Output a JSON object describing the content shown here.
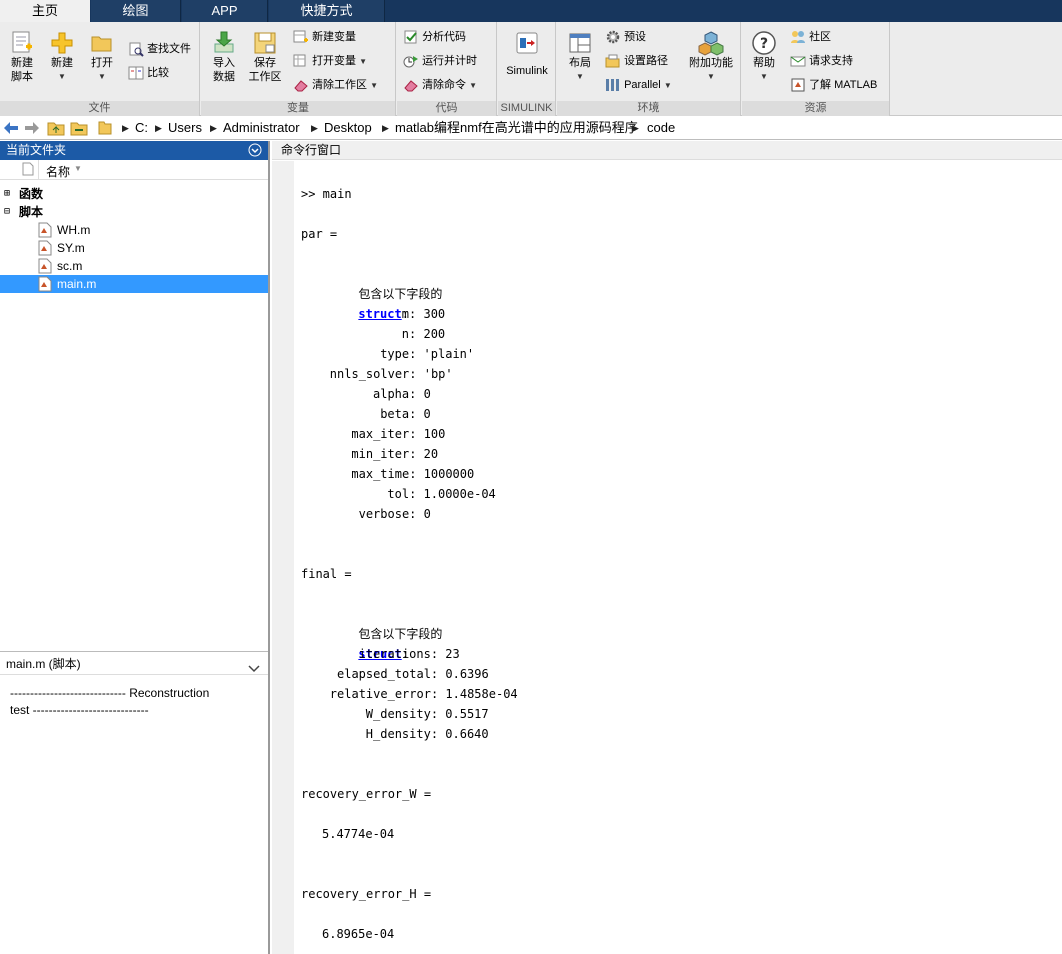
{
  "tabs": [
    "主页",
    "绘图",
    "APP",
    "快捷方式"
  ],
  "ribbon": {
    "file": {
      "label": "文件",
      "new_script": "新建\n脚本",
      "new": "新建",
      "open": "打开",
      "find_files": "查找文件",
      "compare": "比较"
    },
    "variable": {
      "label": "变量",
      "import_data": "导入\n数据",
      "save_workspace": "保存\n工作区",
      "new_variable": "新建变量",
      "open_variable": "打开变量",
      "clear_workspace": "清除工作区"
    },
    "code": {
      "label": "代码",
      "analyze_code": "分析代码",
      "run_and_time": "运行并计时",
      "clear_commands": "清除命令"
    },
    "simulink": {
      "label": "SIMULINK",
      "simulink": "Simulink"
    },
    "environment": {
      "label": "环境",
      "layout": "布局",
      "preferences": "预设",
      "set_path": "设置路径",
      "parallel": "Parallel",
      "add_ons": "附加功能"
    },
    "resources": {
      "label": "资源",
      "help": "帮助",
      "community": "社区",
      "request_support": "请求支持",
      "learn_matlab": "了解 MATLAB"
    }
  },
  "address": {
    "path": [
      "C:",
      "Users",
      "Administrator",
      "Desktop",
      "matlab编程nmf在高光谱中的应用源码程序",
      "code"
    ]
  },
  "current_folder": {
    "title": "当前文件夹",
    "column_name": "名称",
    "groups": [
      "函数",
      "脚本"
    ],
    "files": [
      "WH.m",
      "SY.m",
      "sc.m",
      "main.m"
    ],
    "selected": "main.m"
  },
  "details": {
    "title": "main.m  (脚本)",
    "line1": "----------------------------- Reconstruction",
    "line2": "test -----------------------------"
  },
  "command_window": {
    "title": "命令行窗口",
    "prompt": ">> main",
    "par_header": "par =",
    "struct_intro": "包含以下字段的",
    "struct_link": "struct",
    "struct_colon": ":",
    "par_fields": [
      {
        "name": "m",
        "value": "300"
      },
      {
        "name": "n",
        "value": "200"
      },
      {
        "name": "type",
        "value": "'plain'"
      },
      {
        "name": "nnls_solver",
        "value": "'bp'"
      },
      {
        "name": "alpha",
        "value": "0"
      },
      {
        "name": "beta",
        "value": "0"
      },
      {
        "name": "max_iter",
        "value": "100"
      },
      {
        "name": "min_iter",
        "value": "20"
      },
      {
        "name": "max_time",
        "value": "1000000"
      },
      {
        "name": "tol",
        "value": "1.0000e-04"
      },
      {
        "name": "verbose",
        "value": "0"
      }
    ],
    "final_header": "final =",
    "final_fields": [
      {
        "name": "iterations",
        "value": "23"
      },
      {
        "name": "elapsed_total",
        "value": "0.6396"
      },
      {
        "name": "relative_error",
        "value": "1.4858e-04"
      },
      {
        "name": "W_density",
        "value": "0.5517"
      },
      {
        "name": "H_density",
        "value": "0.6640"
      }
    ],
    "recW_header": "recovery_error_W =",
    "recW_value": "5.4774e-04",
    "recH_header": "recovery_error_H =",
    "recH_value": "6.8965e-04"
  }
}
